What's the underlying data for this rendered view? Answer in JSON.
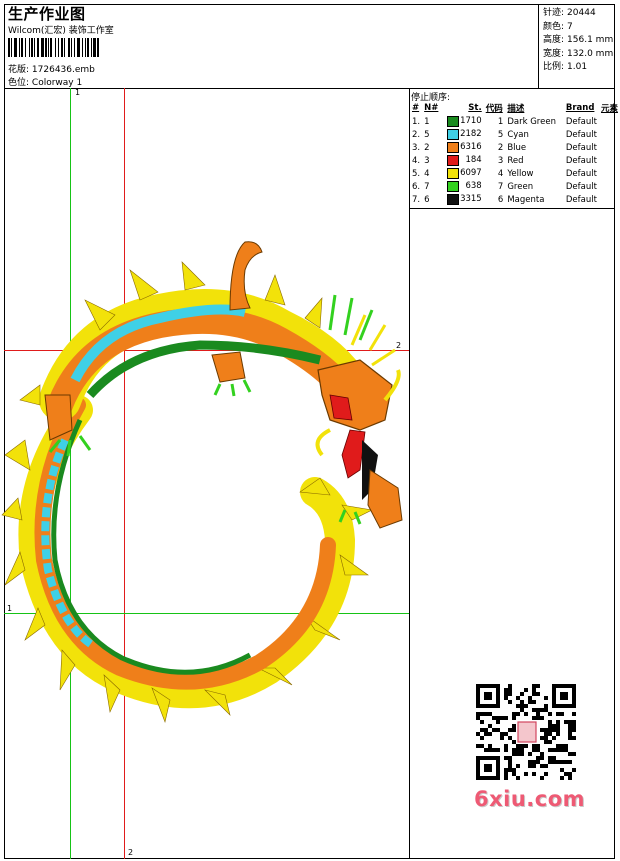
{
  "header": {
    "title": "生产作业图",
    "company": "Wilcom(汇宏) 装饰工作室",
    "design_label": "花版:",
    "design_value": "1726436.emb",
    "colorway_label": "色位:",
    "colorway_value": "Colorway 1"
  },
  "specs": [
    {
      "label": "针迹:",
      "value": "20444"
    },
    {
      "label": "颜色:",
      "value": "7"
    },
    {
      "label": "高度:",
      "value": "156.1 mm"
    },
    {
      "label": "宽度:",
      "value": "132.0 mm"
    },
    {
      "label": "比例:",
      "value": "1.01"
    }
  ],
  "sequence": {
    "title": "停止顺序:",
    "headers": [
      "#",
      "N#",
      "St.",
      "代码",
      "描述",
      "Brand",
      "元素"
    ],
    "rows": [
      {
        "idx": "1.",
        "n": "1",
        "color": "#1a8a1f",
        "st": "1710",
        "code": "1",
        "desc": "Dark Green",
        "brand": "Default"
      },
      {
        "idx": "2.",
        "n": "5",
        "color": "#3fd0e6",
        "st": "2182",
        "code": "5",
        "desc": "Cyan",
        "brand": "Default"
      },
      {
        "idx": "3.",
        "n": "2",
        "color": "#ef7f1a",
        "st": "6316",
        "code": "2",
        "desc": "Blue",
        "brand": "Default"
      },
      {
        "idx": "4.",
        "n": "3",
        "color": "#e01b1b",
        "st": "184",
        "code": "3",
        "desc": "Red",
        "brand": "Default"
      },
      {
        "idx": "5.",
        "n": "4",
        "color": "#f2e20a",
        "st": "6097",
        "code": "4",
        "desc": "Yellow",
        "brand": "Default"
      },
      {
        "idx": "6.",
        "n": "7",
        "color": "#33d11f",
        "st": "638",
        "code": "7",
        "desc": "Green",
        "brand": "Default"
      },
      {
        "idx": "7.",
        "n": "6",
        "color": "#111111",
        "st": "3315",
        "code": "6",
        "desc": "Magenta",
        "brand": "Default"
      }
    ]
  },
  "guides": {
    "green_label": "1",
    "red_label": "2",
    "green_color": "#16c316",
    "red_color": "#e01b1b"
  },
  "watermark": "6xiu.com"
}
